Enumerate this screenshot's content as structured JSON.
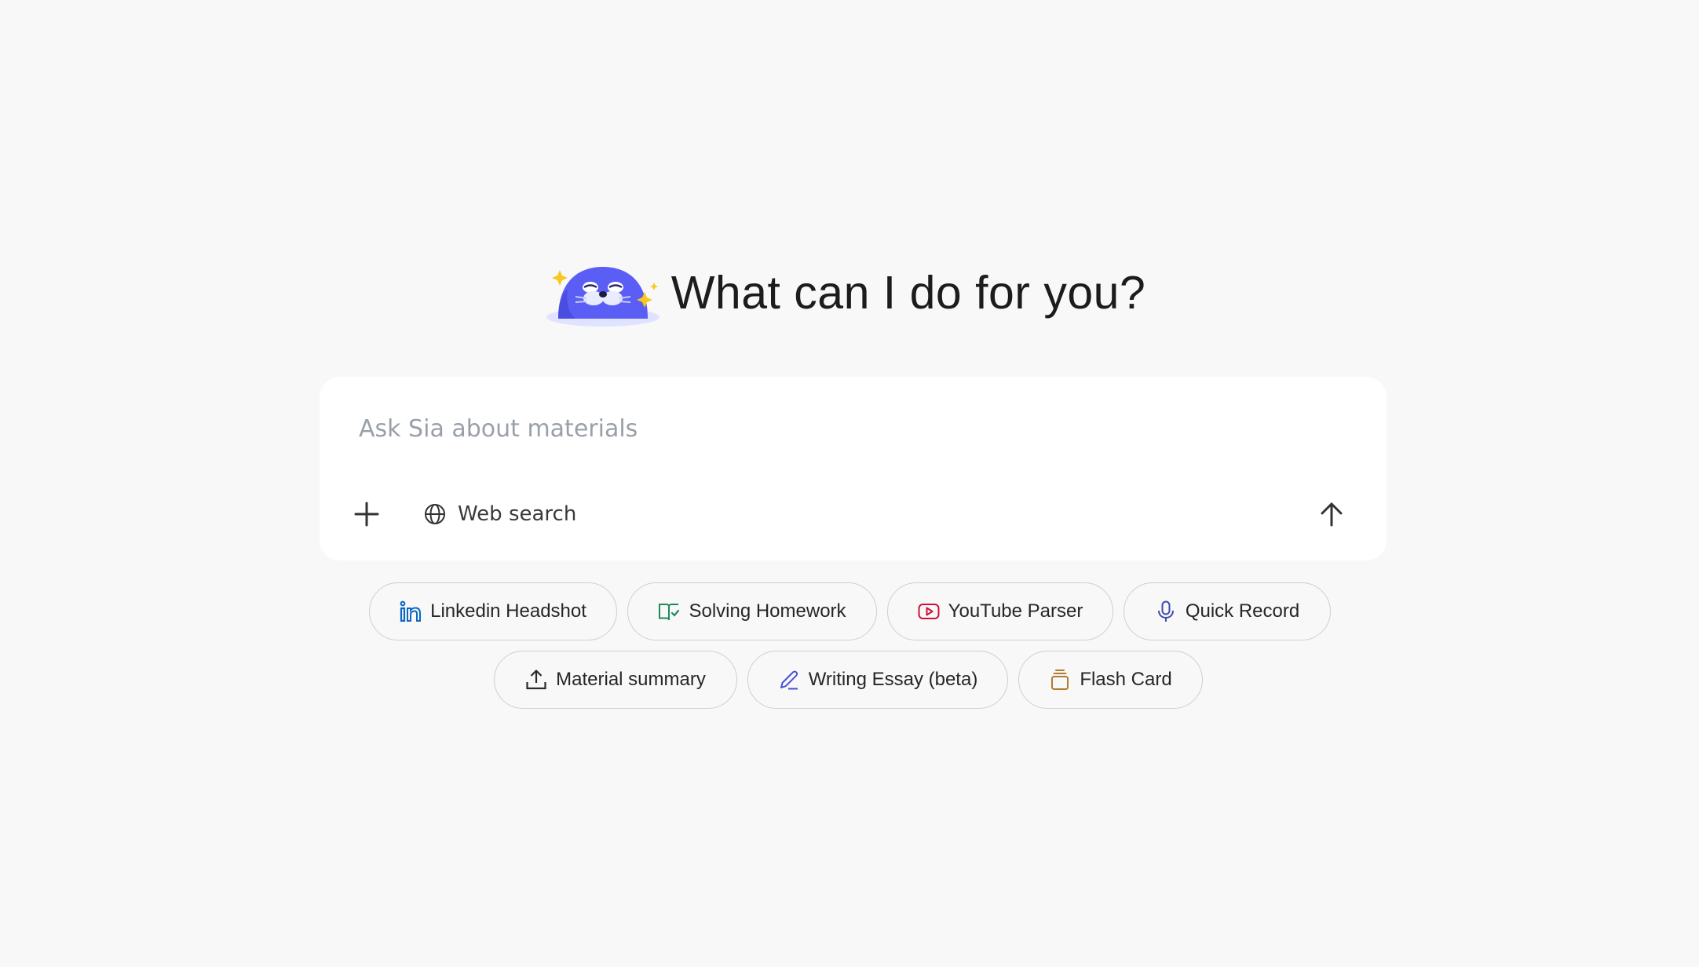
{
  "hero": {
    "title": "What can I do for you?",
    "mascot_icon": "seal-mascot-icon",
    "mascot_color": "#5b5ef4"
  },
  "composer": {
    "placeholder": "Ask Sia about materials",
    "value": "",
    "add_icon": "plus-icon",
    "web_search": {
      "label": "Web search",
      "icon": "globe-icon"
    },
    "send_icon": "arrow-up-icon"
  },
  "quick_actions": {
    "row1": [
      {
        "label": "Linkedin Headshot",
        "icon": "linkedin-icon",
        "color": "#0a66c2"
      },
      {
        "label": "Solving Homework",
        "icon": "book-check-icon",
        "color": "#1e8a5a"
      },
      {
        "label": "YouTube Parser",
        "icon": "youtube-icon",
        "color": "#d0103a"
      },
      {
        "label": "Quick Record",
        "icon": "microphone-icon",
        "color": "#3f4aa8"
      }
    ],
    "row2": [
      {
        "label": "Material summary",
        "icon": "upload-icon",
        "color": "#2a2a2a"
      },
      {
        "label": "Writing Essay (beta)",
        "icon": "pencil-icon",
        "color": "#4b4fd6"
      },
      {
        "label": "Flash Card",
        "icon": "cards-stack-icon",
        "color": "#b27a2e"
      }
    ]
  }
}
